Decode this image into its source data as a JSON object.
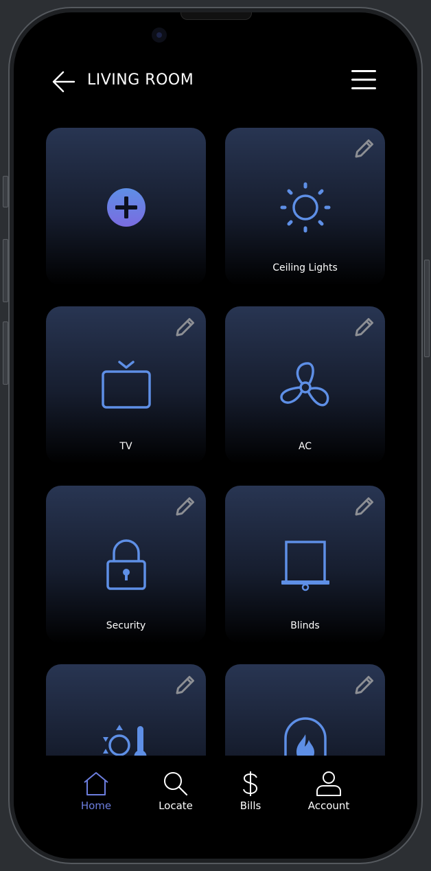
{
  "header": {
    "title": "LIVING ROOM"
  },
  "tiles": [
    {
      "label": "",
      "icon": "add-icon"
    },
    {
      "label": "Ceiling Lights",
      "icon": "sun-icon"
    },
    {
      "label": "TV",
      "icon": "tv-icon"
    },
    {
      "label": "AC",
      "icon": "fan-icon"
    },
    {
      "label": "Security",
      "icon": "lock-icon"
    },
    {
      "label": "Blinds",
      "icon": "blinds-icon"
    },
    {
      "label": "",
      "icon": "weather-thermometer-icon"
    },
    {
      "label": "",
      "icon": "fireplace-icon"
    }
  ],
  "nav": [
    {
      "label": "Home",
      "icon": "home-icon",
      "active": true
    },
    {
      "label": "Locate",
      "icon": "search-icon",
      "active": false
    },
    {
      "label": "Bills",
      "icon": "dollar-icon",
      "active": false
    },
    {
      "label": "Account",
      "icon": "user-icon",
      "active": false
    }
  ],
  "colors": {
    "accent": "#6d7fe0",
    "icon_blue": "#5e8fe6",
    "background": "#000000",
    "tile_top": "#283552"
  }
}
